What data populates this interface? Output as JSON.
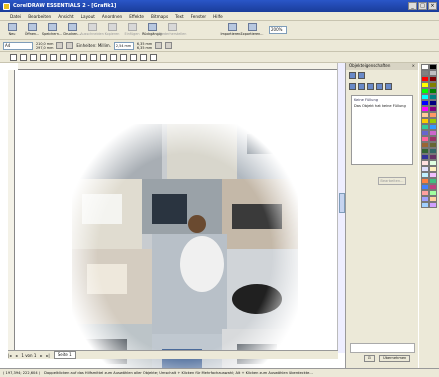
{
  "window": {
    "title": "CorelDRAW ESSENTIALS 2 - [Grafik1]"
  },
  "menu": [
    "Datei",
    "Bearbeiten",
    "Ansicht",
    "Layout",
    "Anordnen",
    "Effekte",
    "Bitmaps",
    "Text",
    "Fenster",
    "Hilfe"
  ],
  "toolbar": {
    "buttons": [
      {
        "label": "Neu",
        "dim": false
      },
      {
        "label": "Öffnen...",
        "dim": false
      },
      {
        "label": "Speichern...",
        "dim": false
      },
      {
        "label": "Drucken...",
        "dim": false
      },
      {
        "label": "Ausschneiden",
        "dim": true
      },
      {
        "label": "Kopieren",
        "dim": true
      },
      {
        "label": "Einfügen",
        "dim": true
      },
      {
        "label": "Rückgängig",
        "dim": false
      },
      {
        "label": "Wiederherstellen",
        "dim": true
      },
      {
        "label": "Importieren...",
        "dim": false
      },
      {
        "label": "Exportieren...",
        "dim": false
      }
    ],
    "zoom": "200%"
  },
  "propbar": {
    "paper": "A4",
    "width": "210,0 mm",
    "height": "297,0 mm",
    "units_label": "Einheiten: Millim.",
    "nudge": "2,54 mm",
    "dup_x": "6,35 mm",
    "dup_y": "6,35 mm"
  },
  "docker": {
    "title": "Objekteigenschaften",
    "fill_heading": "Keine Füllung",
    "fill_text": "Das Objekt hat keine Füllung",
    "edit_button": "Bearbeiten...",
    "apply_button": "Übernehmen"
  },
  "pagenav": {
    "page_count": "1 von 1",
    "tab": "Seite 1"
  },
  "status": {
    "coords": "( 197,394; 222,604 )",
    "hint": "Doppelklicken auf das Hilfsmittel zum Auswählen aller Objekte; Umschalt + Klicken für Mehrfachauswahl; Alt + Klicken zum Auswählen überdeckte..."
  },
  "palette_colors": [
    "#ffffff",
    "#000000",
    "#808080",
    "#c0c0c0",
    "#ff0000",
    "#800000",
    "#ffff00",
    "#808000",
    "#00ff00",
    "#008000",
    "#00ffff",
    "#008080",
    "#0000ff",
    "#000080",
    "#ff00ff",
    "#800080",
    "#ffcc99",
    "#ff9966",
    "#ffcc00",
    "#99cc00",
    "#33cc99",
    "#3399ff",
    "#6666cc",
    "#cc66cc",
    "#ff6699",
    "#993366",
    "#996633",
    "#666633",
    "#336633",
    "#336666",
    "#333399",
    "#663366",
    "#ffe0e0",
    "#e0ffe0",
    "#e0e0ff",
    "#fff0c0",
    "#c0f0ff",
    "#f0c0ff",
    "#ff8040",
    "#40c080",
    "#4080ff",
    "#c04080",
    "#ffa0a0",
    "#a0ffa0",
    "#a0a0ff",
    "#ffd0a0",
    "#a0d0ff",
    "#d0a0ff"
  ]
}
